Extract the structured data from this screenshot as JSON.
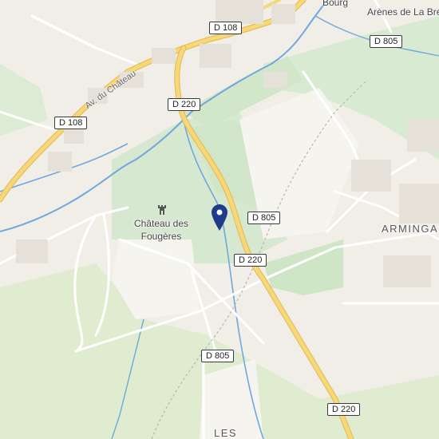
{
  "map": {
    "colors": {
      "land": "#f1eee8",
      "green": "#d8ead1",
      "park": "#e4eedd",
      "water": "#6fa8dc",
      "road_major": "#f4cf6b",
      "road_minor": "#ffffff",
      "pin": "#1f3c8a"
    },
    "road_labels": [
      {
        "id": "d108-north",
        "text": "D 108"
      },
      {
        "id": "d805-northeast",
        "text": "D 805"
      },
      {
        "id": "d220-north",
        "text": "D 220"
      },
      {
        "id": "d108-west",
        "text": "D 108"
      },
      {
        "id": "d805-center",
        "text": "D 805"
      },
      {
        "id": "d220-center",
        "text": "D 220"
      },
      {
        "id": "d805-south",
        "text": "D 805"
      },
      {
        "id": "d220-south",
        "text": "D 220"
      }
    ],
    "street_labels": [
      {
        "id": "av-du-chateau",
        "text": "Av. du Château"
      }
    ],
    "place_labels": [
      {
        "id": "bourg",
        "text": "Bourg"
      },
      {
        "id": "arenes",
        "text": "Arènes de La Bré"
      },
      {
        "id": "armingas",
        "text": "ARMINGAS"
      },
      {
        "id": "les",
        "text": "LES"
      }
    ],
    "poi": {
      "name_line1": "Château des",
      "name_line2": "Fougères",
      "icon": "castle-icon"
    },
    "marker": {
      "icon": "location-pin-icon"
    }
  }
}
